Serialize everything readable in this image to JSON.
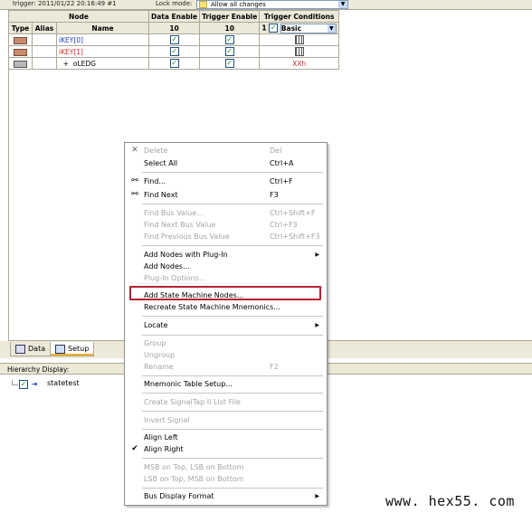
{
  "top_bar": {
    "trigger_text": "trigger: 2011/01/22 20:16:49  #1",
    "lock_mode_label": "Lock mode:",
    "lock_mode_value": "Allow all changes"
  },
  "table": {
    "group_header": "Node",
    "headers": {
      "type": "Type",
      "alias": "Alias",
      "name": "Name",
      "data_enable": "Data Enable",
      "trigger_enable": "Trigger Enable",
      "trigger_conditions": "Trigger Conditions"
    },
    "counts": {
      "data_enable": "10",
      "trigger_enable": "10",
      "trigger_conditions_num": "1",
      "trigger_conditions_value": "Basic"
    },
    "rows": [
      {
        "name": "iKEY[0]",
        "name_color": "#1f3fbf",
        "trigger_cond": ""
      },
      {
        "name": "iKEY[1]",
        "name_color": "#d12a2a",
        "trigger_cond": ""
      },
      {
        "name": "oLEDG",
        "name_color": "#000000",
        "expander": "+",
        "trigger_cond": "XXh"
      }
    ]
  },
  "tabs": {
    "data": "Data",
    "setup": "Setup"
  },
  "hierarchy": {
    "title": "Hierarchy Display:",
    "item": "statetest"
  },
  "context_menu": {
    "items": [
      {
        "label": "Delete",
        "shortcut": "Del",
        "disabled": true,
        "icon": "delete-x-icon"
      },
      {
        "label": "Select All",
        "shortcut": "Ctrl+A"
      },
      {
        "label": "Find...",
        "shortcut": "Ctrl+F",
        "icon": "binoculars-icon"
      },
      {
        "label": "Find Next",
        "shortcut": "F3",
        "icon": "find-next-icon"
      },
      {
        "label": "Find Bus Value...",
        "shortcut": "Ctrl+Shift+F",
        "disabled": true
      },
      {
        "label": "Find Next Bus Value",
        "shortcut": "Ctrl+F3",
        "disabled": true
      },
      {
        "label": "Find Previous Bus Value",
        "shortcut": "Ctrl+Shift+F3",
        "disabled": true
      },
      {
        "label": "Add Nodes with Plug-In",
        "submenu": true
      },
      {
        "label": "Add Nodes..."
      },
      {
        "label": "Plug-In Options...",
        "disabled": true
      },
      {
        "label": "Add State Machine Nodes..."
      },
      {
        "label": "Recreate State Machine Mnemonics..."
      },
      {
        "label": "Locate",
        "submenu": true
      },
      {
        "label": "Group",
        "disabled": true
      },
      {
        "label": "Ungroup",
        "disabled": true
      },
      {
        "label": "Rename",
        "shortcut": "F2",
        "disabled": true
      },
      {
        "label": "Mnemonic Table Setup..."
      },
      {
        "label": "Create SignalTap II List File",
        "disabled": true
      },
      {
        "label": "Invert Signal",
        "disabled": true
      },
      {
        "label": "Align Left"
      },
      {
        "label": "Align Right",
        "checked": true
      },
      {
        "label": "MSB on Top, LSB on Bottom",
        "disabled": true
      },
      {
        "label": "LSB on Top, MSB on Bottom",
        "disabled": true
      },
      {
        "label": "Bus Display Format",
        "submenu": true
      }
    ]
  },
  "watermark": "www. hex55. com"
}
